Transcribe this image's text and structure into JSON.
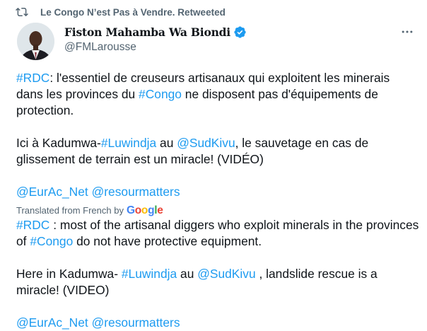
{
  "retweet": {
    "label": "Le Congo N’est Pas à Vendre. Retweeted",
    "icon": "retweet-icon"
  },
  "author": {
    "display_name": "Fiston Mahamba Wa Biondi",
    "handle": "@FMLarousse",
    "verified": true
  },
  "original": {
    "p1": [
      {
        "type": "link",
        "text": "#RDC"
      },
      {
        "type": "text",
        "text": ": l'essentiel de creuseurs artisanaux qui exploitent les minerais dans les provinces du "
      },
      {
        "type": "link",
        "text": "#Congo"
      },
      {
        "type": "text",
        "text": " ne disposent pas d'équipements de protection."
      }
    ],
    "p2": [
      {
        "type": "text",
        "text": "Ici à Kadumwa-"
      },
      {
        "type": "link",
        "text": "#Luwindja"
      },
      {
        "type": "text",
        "text": " au "
      },
      {
        "type": "link",
        "text": "@SudKivu"
      },
      {
        "type": "text",
        "text": ", le sauvetage en cas de glissement de terrain est un miracle! (VIDÉO)"
      }
    ],
    "p3": [
      {
        "type": "link",
        "text": "@EurAc_Net"
      },
      {
        "type": "text",
        "text": " "
      },
      {
        "type": "link",
        "text": "@resourmatters"
      }
    ]
  },
  "translation": {
    "note": "Translated from French by",
    "provider": "Google",
    "p1": [
      {
        "type": "link",
        "text": "#RDC"
      },
      {
        "type": "text",
        "text": " : most of the artisanal diggers who exploit minerals in the provinces of "
      },
      {
        "type": "link",
        "text": "#Congo"
      },
      {
        "type": "text",
        "text": " do not have protective equipment."
      }
    ],
    "p2": [
      {
        "type": "text",
        "text": "Here in Kadumwa- "
      },
      {
        "type": "link",
        "text": "#Luwindja"
      },
      {
        "type": "text",
        "text": " au "
      },
      {
        "type": "link",
        "text": "@SudKivu"
      },
      {
        "type": "text",
        "text": " , landslide rescue is a miracle! (VIDEO)"
      }
    ],
    "p3": [
      {
        "type": "link",
        "text": "@EurAc_Net"
      },
      {
        "type": "text",
        "text": " "
      },
      {
        "type": "link",
        "text": "@resourmatters"
      }
    ]
  },
  "colors": {
    "link": "#1d9bf0",
    "secondary_text": "#536471",
    "verified_badge": "#1d9bf0"
  }
}
